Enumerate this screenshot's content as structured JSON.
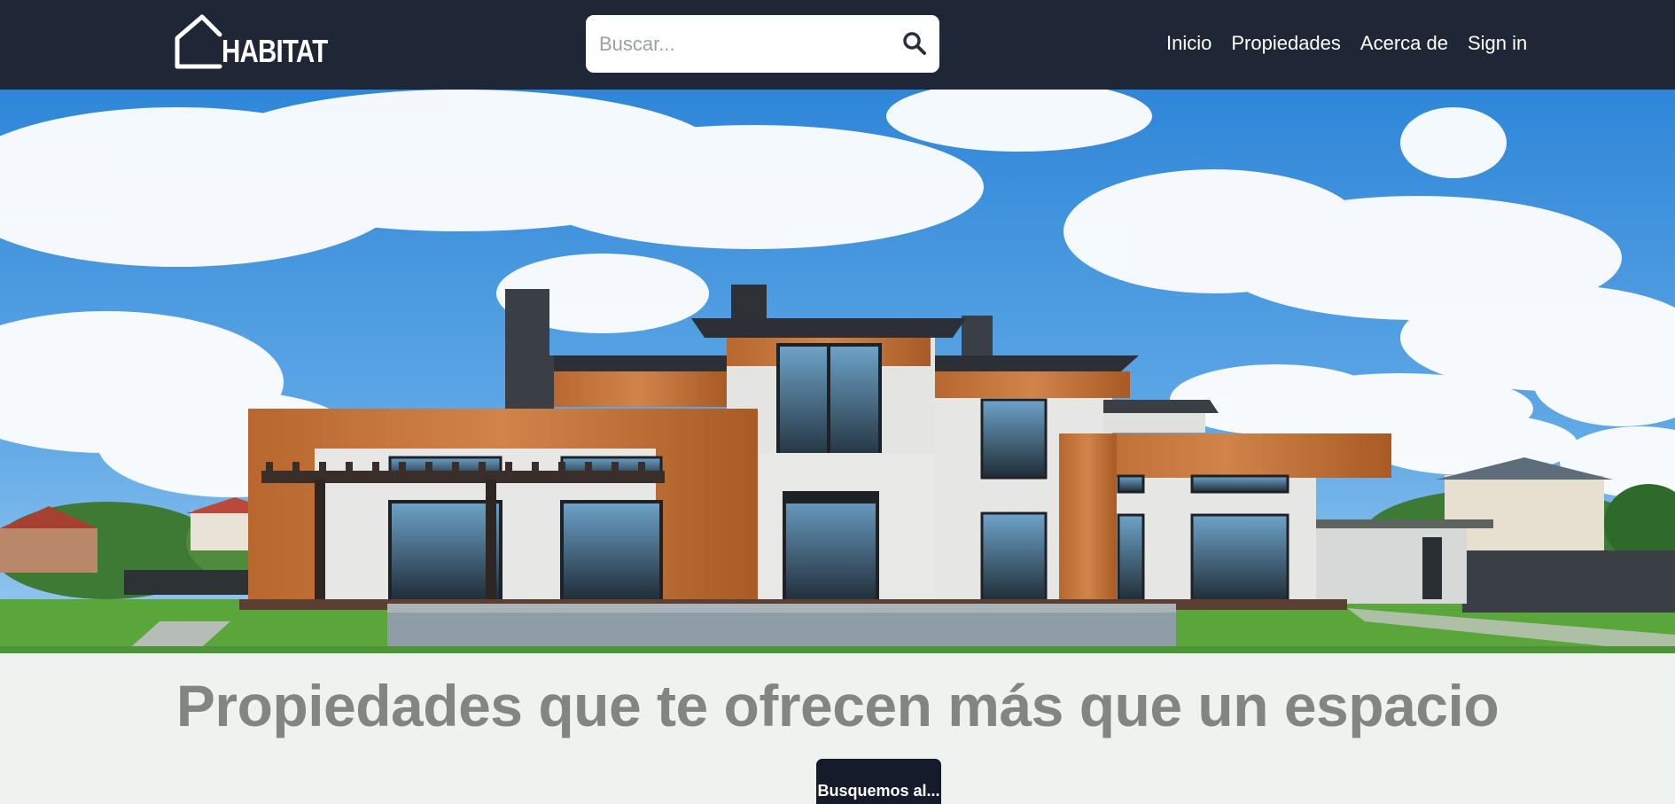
{
  "brand": {
    "name": "HABITAT",
    "logo_icon": "house-outline-icon"
  },
  "search": {
    "placeholder": "Buscar...",
    "value": "",
    "icon": "search-icon"
  },
  "nav": {
    "items": [
      {
        "label": "Inicio"
      },
      {
        "label": "Propiedades"
      },
      {
        "label": "Acerca de"
      },
      {
        "label": "Sign in"
      }
    ]
  },
  "hero": {
    "image": "modern-house-photo"
  },
  "main": {
    "tagline": "Propiedades que te ofrecen más que un espacio",
    "cta_label": "Busquemos al..."
  },
  "colors": {
    "navbar_bg": "#1f2736",
    "page_bg": "#eff3f0",
    "cta_bg": "#151b2b",
    "tagline": "#838583"
  }
}
